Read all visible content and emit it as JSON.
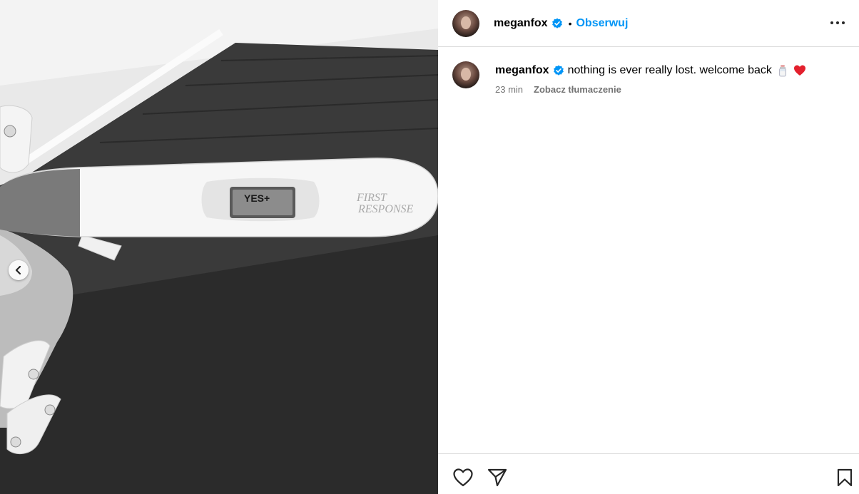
{
  "post": {
    "username": "meganfox",
    "dot": "•",
    "follow_label": "Obserwuj",
    "caption": "nothing is ever really lost. welcome back",
    "time": "23 min",
    "translate_label": "Zobacz tłumaczenie"
  },
  "media": {
    "test_window_text": "YES+",
    "brand_text_1": "FIRST",
    "brand_text_2": "RESPONSE"
  },
  "colors": {
    "accent": "#0095f6",
    "verified": "#0095f6",
    "heart": "#e3202d",
    "border": "#dbdbdb",
    "muted": "#737373"
  },
  "icons": {
    "more": "more-options-icon",
    "prev": "chevron-left-icon",
    "like": "heart-icon",
    "share": "paper-plane-icon",
    "save": "bookmark-icon",
    "verified": "verified-badge-icon"
  }
}
